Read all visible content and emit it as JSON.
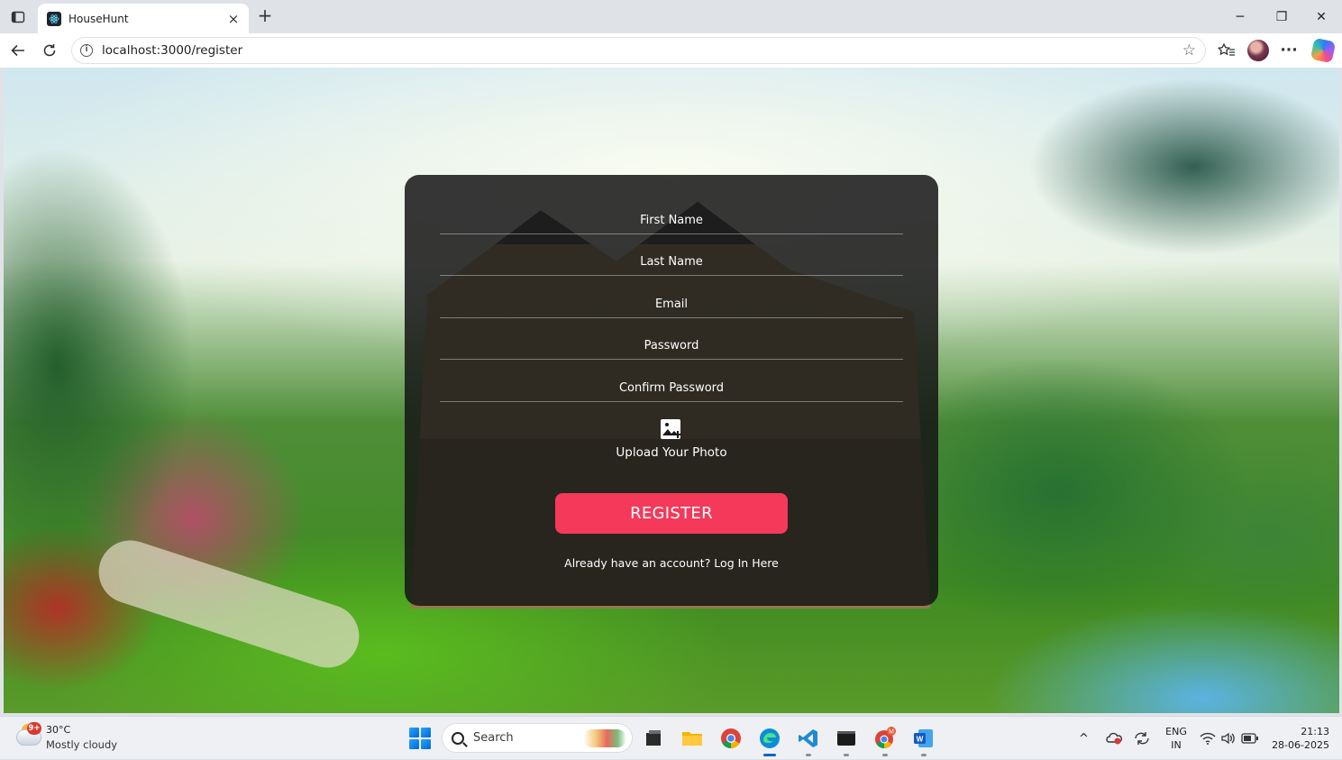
{
  "browser": {
    "tab_title": "HouseHunt",
    "tab_close": "×",
    "new_tab": "+",
    "url": "localhost:3000/register",
    "window_controls": {
      "minimize": "─",
      "restore": "❐",
      "close": "✕"
    }
  },
  "form": {
    "fields": [
      {
        "placeholder": "First Name"
      },
      {
        "placeholder": "Last Name"
      },
      {
        "placeholder": "Email"
      },
      {
        "placeholder": "Password"
      },
      {
        "placeholder": "Confirm Password"
      }
    ],
    "upload_label": "Upload Your Photo",
    "register_label": "REGISTER",
    "login_prompt": "Already have an account? Log In Here",
    "accent_color": "#f4395a"
  },
  "taskbar": {
    "weather_badge": "9+",
    "temperature": "30°C",
    "condition": "Mostly cloudy",
    "search_label": "Search",
    "apps": [
      "file-explorer-icon",
      "folder-icon",
      "chrome-icon",
      "edge-icon",
      "vscode-icon",
      "terminal-icon",
      "chrome-profile-icon",
      "word-icon"
    ],
    "language_line1": "ENG",
    "language_line2": "IN",
    "time": "21:13",
    "date": "28-06-2025"
  }
}
